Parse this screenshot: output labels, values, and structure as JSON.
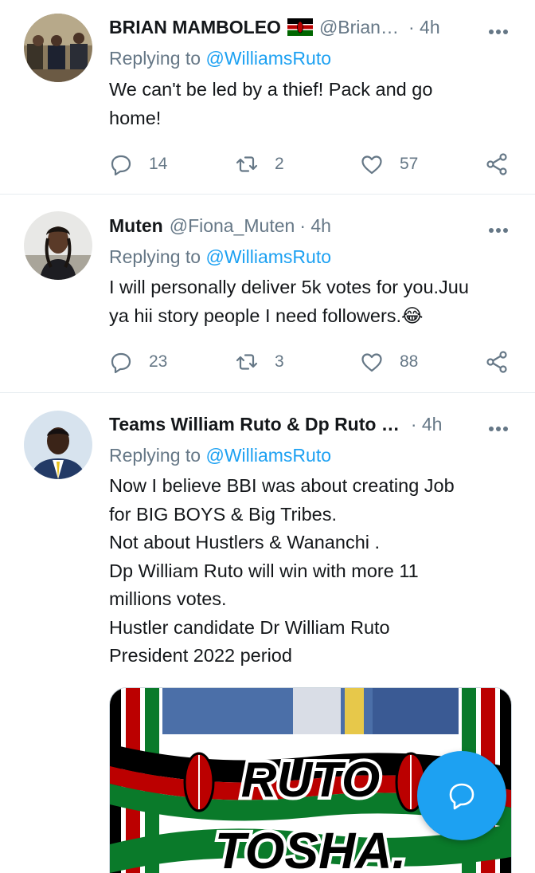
{
  "tweets": [
    {
      "name": "BRIAN MAMBOLEO",
      "handle": "@Brian…",
      "time": "· 4h",
      "replying_prefix": "Replying to",
      "replying_to": "@WilliamsRuto",
      "text": "We can't be led by a thief! Pack and go\nhome!",
      "replies": "14",
      "retweets": "2",
      "likes": "57"
    },
    {
      "name": "Muten",
      "handle": "@Fiona_Muten",
      "time": "· 4h",
      "replying_prefix": "Replying to",
      "replying_to": "@WilliamsRuto",
      "text": "I will personally deliver 5k votes for you.Juu\nya hii story people I need followers.😂",
      "replies": "23",
      "retweets": "3",
      "likes": "88"
    },
    {
      "name": "Teams William Ruto & Dp Ruto …",
      "handle": "",
      "time": "· 4h",
      "replying_prefix": "Replying to",
      "replying_to": "@WilliamsRuto",
      "text": "Now I believe BBI was about creating Job\nfor BIG BOYS & Big Tribes.\nNot about  Hustlers & Wananchi .\nDp William Ruto will win with more 11\nmillions votes.\nHustler candidate Dr  William Ruto\nPresident 2022 period",
      "media_text_1": "RUTO",
      "media_text_2": "TOSHA."
    }
  ],
  "colors": {
    "accent": "#1da1f2",
    "secondary_text": "#657786",
    "divider": "#e6ecf0"
  }
}
